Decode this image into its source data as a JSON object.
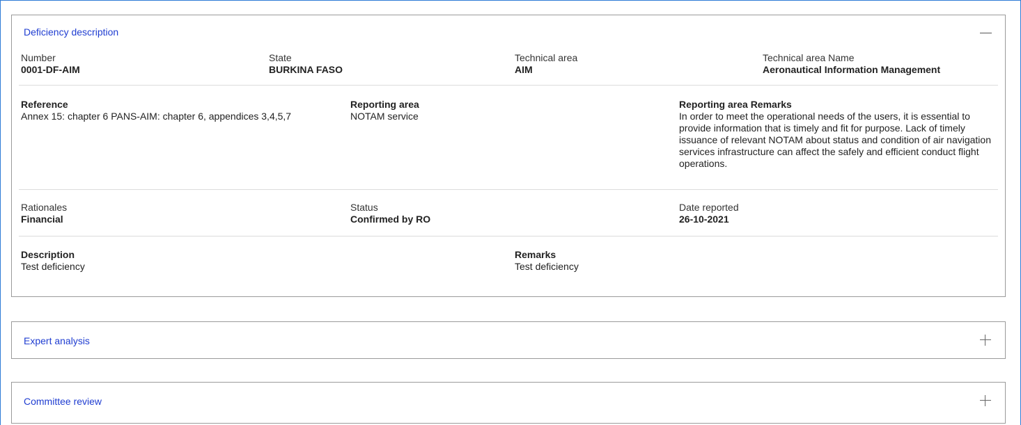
{
  "deficiency": {
    "title": "Deficiency description",
    "row1": [
      {
        "label": "Number",
        "value": "0001-DF-AIM"
      },
      {
        "label": "State",
        "value": "BURKINA FASO"
      },
      {
        "label": "Technical area",
        "value": "AIM"
      },
      {
        "label": "Technical area Name",
        "value": "Aeronautical Information Management"
      }
    ],
    "row2": [
      {
        "label": "Reference",
        "value": "Annex 15: chapter 6 PANS-AIM: chapter 6, appendices 3,4,5,7"
      },
      {
        "label": "Reporting area",
        "value": "NOTAM service"
      },
      {
        "label": "Reporting area Remarks",
        "value": "In order to meet the operational needs of the users, it is essential to provide information that is timely and fit for purpose. Lack of timely issuance of relevant NOTAM about status and condition of air navigation services infrastructure can affect the safely and efficient conduct flight operations."
      }
    ],
    "row3": [
      {
        "label": "Rationales",
        "value": "Financial"
      },
      {
        "label": "Status",
        "value": "Confirmed by RO"
      },
      {
        "label": "Date reported",
        "value": "26-10-2021"
      }
    ],
    "row4": [
      {
        "label": "Description",
        "value": "Test deficiency"
      },
      {
        "label": "Remarks",
        "value": "Test deficiency"
      }
    ]
  },
  "expert_analysis": {
    "title": "Expert analysis"
  },
  "committee_review": {
    "title": "Committee review"
  },
  "colors": {
    "link": "#1f3dd1",
    "frame": "#2e7bd6",
    "border": "#9a9a9a"
  }
}
